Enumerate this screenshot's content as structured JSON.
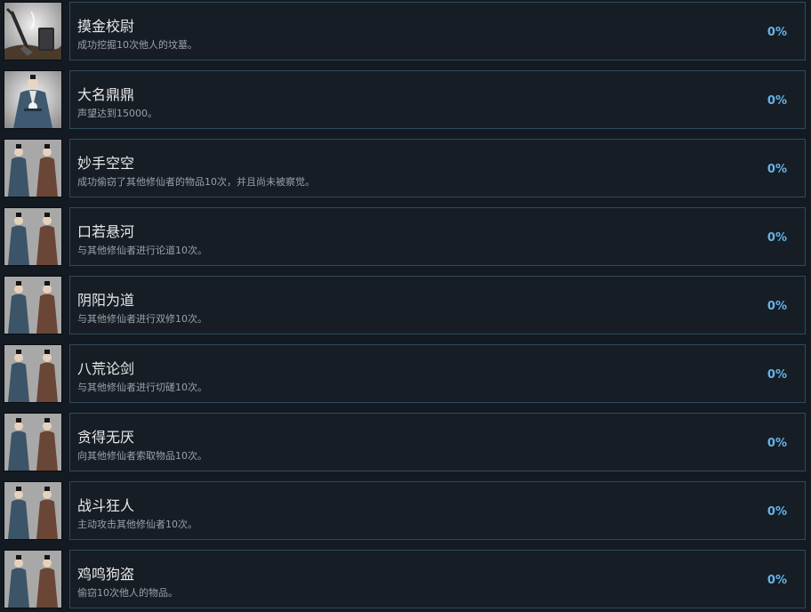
{
  "achievements": [
    {
      "title": "摸金校尉",
      "description": "成功挖掘10次他人的坟墓。",
      "percent": "0%",
      "icon": "grave-digging-icon"
    },
    {
      "title": "大名鼎鼎",
      "description": "声望达到15000。",
      "percent": "0%",
      "icon": "cultivator-portrait-icon"
    },
    {
      "title": "妙手空空",
      "description": "成功偷窃了其他修仙者的物品10次，并且尚未被察觉。",
      "percent": "0%",
      "icon": "two-cultivators-icon"
    },
    {
      "title": "口若悬河",
      "description": "与其他修仙者进行论道10次。",
      "percent": "0%",
      "icon": "two-cultivators-icon"
    },
    {
      "title": "阴阳为道",
      "description": "与其他修仙者进行双修10次。",
      "percent": "0%",
      "icon": "two-cultivators-icon"
    },
    {
      "title": "八荒论剑",
      "description": "与其他修仙者进行切磋10次。",
      "percent": "0%",
      "icon": "two-cultivators-icon"
    },
    {
      "title": "贪得无厌",
      "description": "向其他修仙者索取物品10次。",
      "percent": "0%",
      "icon": "two-cultivators-icon"
    },
    {
      "title": "战斗狂人",
      "description": "主动攻击其他修仙者10次。",
      "percent": "0%",
      "icon": "two-cultivators-icon"
    },
    {
      "title": "鸡鸣狗盗",
      "description": "偷窃10次他人的物品。",
      "percent": "0%",
      "icon": "two-cultivators-icon"
    }
  ]
}
